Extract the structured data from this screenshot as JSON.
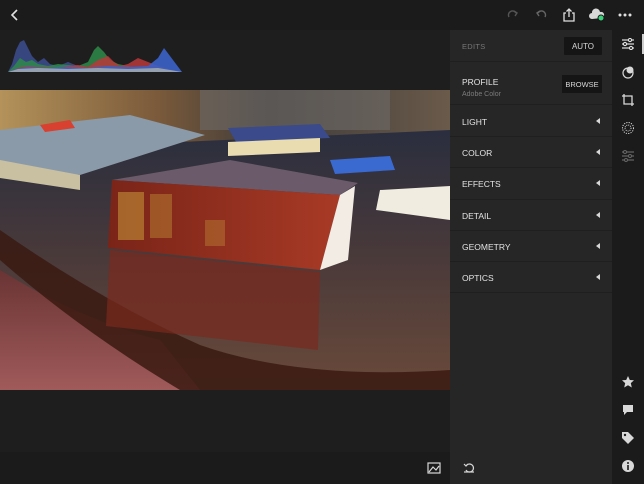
{
  "panel": {
    "edits_label": "EDITS",
    "auto_label": "AUTO",
    "profile": {
      "title": "PROFILE",
      "value": "Adobe Color",
      "browse_label": "BROWSE"
    },
    "sections": [
      {
        "label": "LIGHT"
      },
      {
        "label": "COLOR"
      },
      {
        "label": "EFFECTS"
      },
      {
        "label": "DETAIL"
      },
      {
        "label": "GEOMETRY"
      },
      {
        "label": "OPTICS"
      }
    ]
  },
  "icons": {
    "top": [
      "back-icon",
      "redo-icon",
      "undo-icon",
      "share-icon",
      "cloud-sync-icon",
      "more-icon"
    ],
    "tools": [
      "edit-sliders-icon",
      "presets-icon",
      "crop-icon",
      "selective-icon",
      "healing-icon"
    ],
    "tools_bottom": [
      "star-icon",
      "comment-icon",
      "tag-icon",
      "info-icon"
    ],
    "bottom": [
      "compare-icon",
      "reset-icon"
    ]
  },
  "colors": {
    "accent": "#5aa8ff",
    "cloud_badge": "#39d07a"
  }
}
